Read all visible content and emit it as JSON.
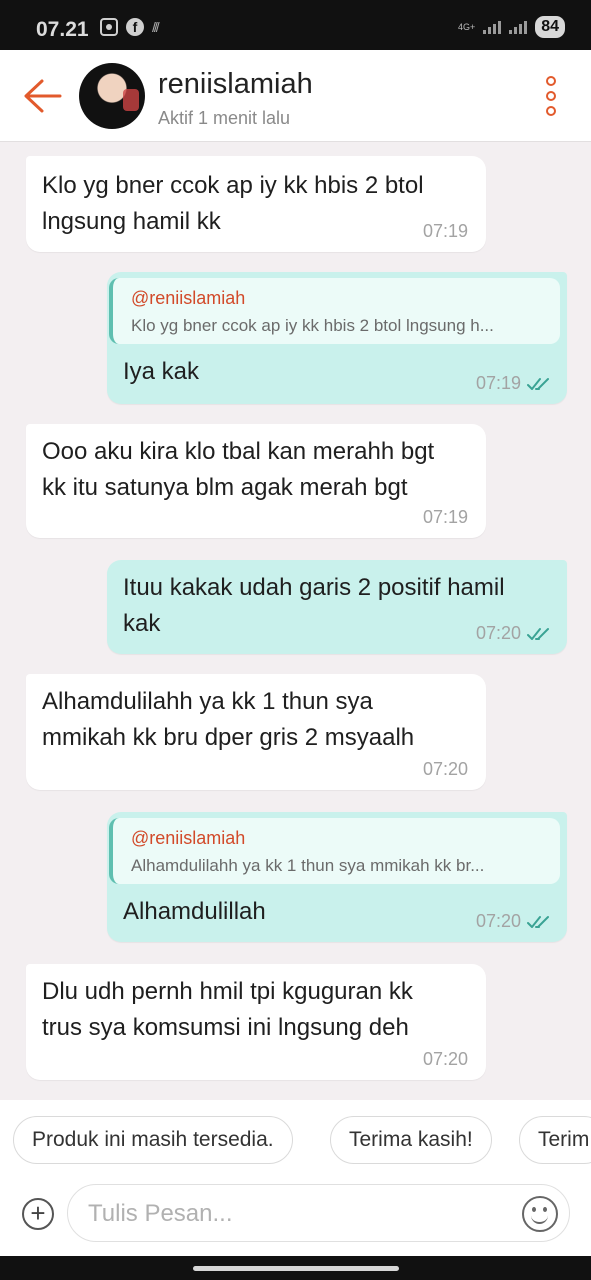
{
  "status_bar": {
    "time": "07.21",
    "network": "4G+",
    "battery": "84",
    "icons": [
      "screenshot-icon",
      "facebook-icon",
      "wifi-signal-icon",
      "cell-signal-icon"
    ]
  },
  "header": {
    "contact_name": "reniislamiah",
    "contact_status": "Aktif 1 menit lalu",
    "accent_color": "#e25a2c"
  },
  "messages": [
    {
      "direction": "in",
      "lines": [
        "Klo yg bner ccok ap iy kk hbis 2 btol",
        "lngsung hamil kk"
      ],
      "time": "07:19"
    },
    {
      "direction": "out",
      "quote": {
        "name": "@reniislamiah",
        "text": "Klo yg bner ccok ap iy kk hbis 2 btol lngsung h..."
      },
      "lines": [
        "Iya kak"
      ],
      "time": "07:19",
      "read": true
    },
    {
      "direction": "in",
      "lines": [
        "Ooo aku kira klo tbal kan merahh bgt",
        "kk itu satunya blm agak merah bgt"
      ],
      "time": "07:19"
    },
    {
      "direction": "out",
      "lines": [
        "Ituu kakak udah garis 2 positif hamil",
        "kak"
      ],
      "time": "07:20",
      "read": true
    },
    {
      "direction": "in",
      "lines": [
        "Alhamdulilahh ya kk 1 thun sya",
        "mmikah kk bru dper gris 2 msyaalh"
      ],
      "time": "07:20"
    },
    {
      "direction": "out",
      "quote": {
        "name": "@reniislamiah",
        "text": "Alhamdulilahh ya kk 1 thun sya mmikah kk br..."
      },
      "lines": [
        "Alhamdulillah"
      ],
      "time": "07:20",
      "read": true
    },
    {
      "direction": "in",
      "lines": [
        "Dlu udh pernh hmil tpi kguguran kk",
        "trus sya komsumsi ini lngsung deh"
      ],
      "time": "07:20"
    }
  ],
  "quick_replies": [
    "Produk ini masih tersedia.",
    "Terima kasih!",
    "Terim"
  ],
  "composer": {
    "placeholder": "Tulis Pesan..."
  },
  "colors": {
    "incoming_bubble": "#ffffff",
    "outgoing_bubble": "#c9f1ec",
    "chat_background": "#f3eff1",
    "quote_name": "#d24a2a"
  }
}
